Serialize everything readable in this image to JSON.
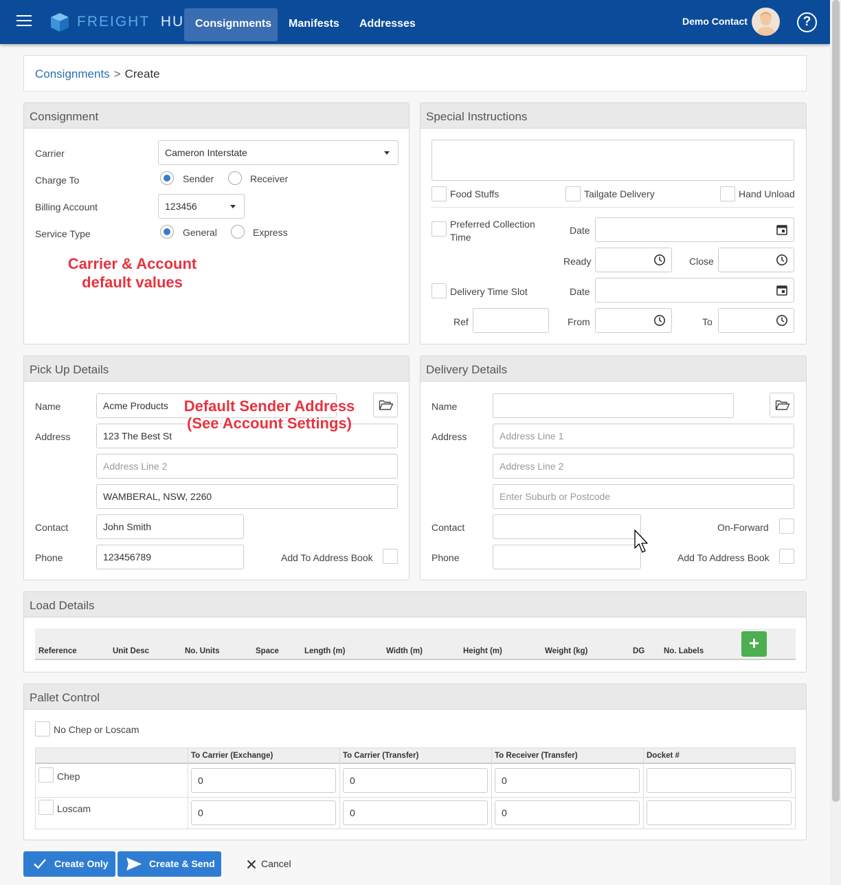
{
  "app": {
    "brand_main": "FREIGHT",
    "brand_sub": "HUB"
  },
  "nav": {
    "tabs": [
      "Consignments",
      "Manifests",
      "Addresses"
    ],
    "user": "Demo Contact"
  },
  "breadcrumb": {
    "parent": "Consignments",
    "sep": ">",
    "current": "Create"
  },
  "consignment": {
    "title": "Consignment",
    "carrier_label": "Carrier",
    "carrier_value": "Cameron Interstate",
    "charge_label": "Charge To",
    "charge_options": [
      "Sender",
      "Receiver"
    ],
    "billing_label": "Billing Account",
    "billing_value": "123456",
    "service_label": "Service Type",
    "service_options": [
      "General",
      "Express"
    ],
    "annotation_line1": "Carrier & Account",
    "annotation_line2": "default values"
  },
  "special": {
    "title": "Special Instructions",
    "food": "Food Stuffs",
    "tailgate": "Tailgate Delivery",
    "hand": "Hand Unload",
    "pref_line1": "Preferred Collection",
    "pref_line2": "Time",
    "date": "Date",
    "ready": "Ready",
    "close": "Close",
    "slot": "Delivery Time Slot",
    "ref": "Ref",
    "from": "From",
    "to": "To"
  },
  "pickup": {
    "title": "Pick Up Details",
    "name_label": "Name",
    "name_value": "Acme Products",
    "address_label": "Address",
    "addr1": "123 The Best St",
    "addr2_ph": "Address Line 2",
    "suburb": "WAMBERAL, NSW, 2260",
    "contact_label": "Contact",
    "contact_value": "John Smith",
    "phone_label": "Phone",
    "phone_value": "123456789",
    "book_label": "Add To Address Book",
    "annotation_line1": "Default Sender Address",
    "annotation_line2": "(See Account Settings)"
  },
  "delivery": {
    "title": "Delivery Details",
    "name_label": "Name",
    "address_label": "Address",
    "addr1_ph": "Address Line 1",
    "addr2_ph": "Address Line 2",
    "suburb_ph": "Enter Suburb or Postcode",
    "contact_label": "Contact",
    "forward_label": "On-Forward",
    "phone_label": "Phone",
    "book_label": "Add To Address Book"
  },
  "load": {
    "title": "Load Details",
    "columns": [
      "Reference",
      "Unit Desc",
      "No. Units",
      "Space",
      "Length (m)",
      "Width (m)",
      "Height (m)",
      "Weight (kg)",
      "DG",
      "No. Labels"
    ],
    "add_symbol": "+"
  },
  "pallet": {
    "title": "Pallet Control",
    "none_label": "No Chep or Loscam",
    "columns": [
      "To Carrier (Exchange)",
      "To Carrier (Transfer)",
      "To Receiver (Transfer)",
      "Docket #"
    ],
    "rows": [
      {
        "name": "Chep",
        "values": [
          "0",
          "0",
          "0"
        ]
      },
      {
        "name": "Loscam",
        "values": [
          "0",
          "0",
          "0"
        ]
      }
    ]
  },
  "actions": {
    "create_only": "Create Only",
    "create_send": "Create & Send",
    "cancel": "Cancel"
  }
}
